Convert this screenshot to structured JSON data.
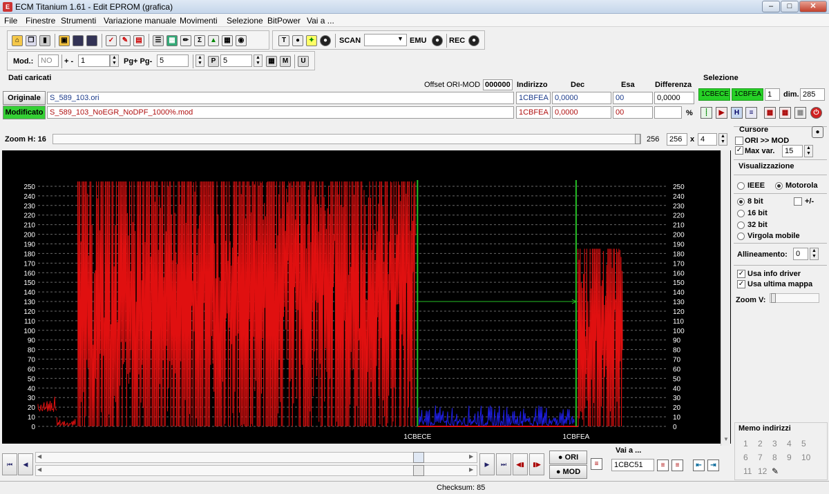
{
  "window": {
    "title": "ECM Titanium 1.61 - Edit EPROM (grafica)"
  },
  "menu": [
    "File",
    "Finestre",
    "Strumenti",
    "Variazione manuale",
    "Movimenti",
    "Selezione",
    "BitPower",
    "Vai a ..."
  ],
  "toolbar": {
    "scan_label": "SCAN",
    "emu_label": "EMU",
    "rec_label": "REC",
    "scan_value": ""
  },
  "toolbar2": {
    "mod_label": "Mod.:",
    "mod_value": "NO",
    "pm_label": "+ -",
    "pm_value": "1",
    "pg_label": "Pg+ Pg-",
    "pg_value": "5",
    "p_value": "5"
  },
  "loaded": {
    "title": "Dati caricati",
    "offset_label": "Offset ORI-MOD",
    "offset_value": "000000",
    "col_indirizzo": "Indirizzo",
    "col_dec": "Dec",
    "col_esa": "Esa",
    "col_diff": "Differenza",
    "ori_button": "Originale",
    "ori_file": "S_589_103.ori",
    "ori_addr": "1CBFEA",
    "ori_dec": "0,0000",
    "ori_esa": "00",
    "ori_diff": "0,0000",
    "mod_button": "Modificato",
    "mod_file": "S_589_103_NoEGR_NoDPF_1000%.mod",
    "mod_addr": "1CBFEA",
    "mod_dec": "0,0000",
    "mod_esa": "00",
    "mod_diff": "",
    "percent": "%"
  },
  "selection": {
    "title": "Selezione",
    "start": "1CBECE",
    "end": "1CBFEA",
    "count": "1",
    "dim_label": "dim.",
    "dim_value": "285"
  },
  "zoom": {
    "label": "Zoom H: 16",
    "val1": "256",
    "val2": "256",
    "x_label": "x",
    "mult": "4"
  },
  "cursor_panel": {
    "title": "Cursore",
    "ori_mod": "ORI >> MOD",
    "maxvar_label": "Max var.",
    "maxvar_value": "15"
  },
  "view_panel": {
    "title": "Visualizzazione",
    "ieee": "IEEE",
    "motorola": "Motorola",
    "bit8": "8 bit",
    "plusminus": "+/-",
    "bit16": "16 bit",
    "bit32": "32 bit",
    "float": "Virgola mobile",
    "align_label": "Allineamento:",
    "align_value": "0",
    "use_driver": "Usa info driver",
    "use_last_map": "Usa ultima mappa",
    "zoom_v": "Zoom V:"
  },
  "memo": {
    "title": "Memo indirizzi",
    "numbers": [
      "1",
      "2",
      "3",
      "4",
      "5",
      "6",
      "7",
      "8",
      "9",
      "10",
      "11",
      "12"
    ]
  },
  "nav": {
    "ori_button": "ORI",
    "mod_button": "MOD",
    "goto_label": "Vai a ...",
    "goto_value": "1CBC51"
  },
  "status": {
    "checksum": "Checksum: 85"
  },
  "chart_data": {
    "type": "line",
    "ylim": [
      0,
      255
    ],
    "yticks": [
      0,
      10,
      20,
      30,
      40,
      50,
      60,
      70,
      80,
      90,
      100,
      110,
      120,
      130,
      140,
      150,
      160,
      170,
      180,
      190,
      200,
      210,
      220,
      230,
      240,
      250
    ],
    "x_markers": [
      {
        "label": "1CBECE",
        "pos": 0.603
      },
      {
        "label": "1CBFEA",
        "pos": 0.855
      }
    ],
    "series": [
      {
        "color": "#e01010",
        "segments": [
          {
            "from": 0.0,
            "to": 0.03,
            "min": 15,
            "max": 32
          },
          {
            "from": 0.03,
            "to": 0.06,
            "min": 0,
            "max": 10
          },
          {
            "from": 0.063,
            "to": 0.49,
            "min": 0,
            "max": 255
          },
          {
            "from": 0.49,
            "to": 0.6,
            "min": 0,
            "max": 255
          },
          {
            "from": 0.858,
            "to": 0.93,
            "min": 0,
            "max": 185
          }
        ]
      },
      {
        "color": "#1e1ee6",
        "segments": [
          {
            "from": 0.605,
            "to": 0.852,
            "min": 0,
            "max": 22
          }
        ]
      }
    ],
    "h_marker": {
      "value": 130,
      "from": 0.603,
      "to": 0.855,
      "color": "#26c026"
    }
  },
  "colors": {
    "chart_bg": "#000000",
    "grid": "#6a6a6a",
    "ori_series": "#e01010",
    "mod_series": "#1e1ee6",
    "marker": "#26c026",
    "sel_green": "#26d026"
  }
}
